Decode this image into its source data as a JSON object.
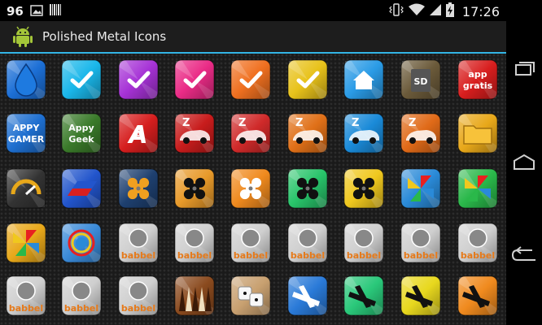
{
  "status_bar": {
    "notification_count": "96",
    "time": "17:26",
    "icons": [
      "image-icon",
      "barcode-icon",
      "vibrate-icon",
      "wifi-icon",
      "signal-icon",
      "battery-charging-icon"
    ]
  },
  "action_bar": {
    "title": "Polished Metal Icons",
    "app_icon": "android-robot-icon",
    "accent_color": "#33b5e5"
  },
  "navigation_bar": {
    "buttons": [
      "recents-icon",
      "home-icon",
      "back-icon"
    ]
  },
  "icon_grid": {
    "rows": [
      [
        {
          "name": "blue-drop-icon",
          "color": "#1c6fd6"
        },
        {
          "name": "cyan-check-icon",
          "color": "#1ab7ea"
        },
        {
          "name": "purple-check-icon",
          "color": "#a632d6"
        },
        {
          "name": "pink-check-icon",
          "color": "#ea2b86"
        },
        {
          "name": "orange-check-icon",
          "color": "#f07020"
        },
        {
          "name": "yellow-check-icon",
          "color": "#e8c21a"
        },
        {
          "name": "home-icon",
          "color": "#2a9be6"
        },
        {
          "name": "sd-card-icon",
          "color": "#6b5a3a"
        },
        {
          "name": "app-gratis-icon",
          "color": "#d81e1e",
          "text": "app\ngratis"
        }
      ],
      [
        {
          "name": "appy-gamer-icon",
          "color": "#1e6fd0",
          "text": "APPY\nGAMER"
        },
        {
          "name": "appy-geek-icon",
          "color": "#3a7a2a",
          "text": "Appy\nGeek"
        },
        {
          "name": "red-a-icon",
          "color": "#d61e1e",
          "text": "A"
        },
        {
          "name": "red-car-icon",
          "color": "#c81c1c"
        },
        {
          "name": "red-car-icon-2",
          "color": "#d02a2a"
        },
        {
          "name": "orange-car-icon",
          "color": "#e07018"
        },
        {
          "name": "blue-car-icon",
          "color": "#1a8ad8"
        },
        {
          "name": "orange-car-icon-2",
          "color": "#e06a18"
        },
        {
          "name": "folder-icon",
          "color": "#e8a81a"
        }
      ],
      [
        {
          "name": "gauge-icon",
          "color": "#333333"
        },
        {
          "name": "flag-stripes-icon",
          "color": "#2255cc"
        },
        {
          "name": "orange-fan-icon",
          "color": "#1e4070"
        },
        {
          "name": "orange-fan-icon-2",
          "color": "#e89a2a"
        },
        {
          "name": "white-fan-icon",
          "color": "#f08a1e"
        },
        {
          "name": "green-fan-icon",
          "color": "#28c46a"
        },
        {
          "name": "yellow-fan-icon",
          "color": "#f0c81e"
        },
        {
          "name": "pinwheel-icon",
          "color": "#2a8ad8"
        },
        {
          "name": "pinwheel-icon-2",
          "color": "#2ab84a"
        }
      ],
      [
        {
          "name": "pinwheel-icon-3",
          "color": "#e8a81a"
        },
        {
          "name": "rainbow-disc-icon",
          "color": "#3a8ad8"
        },
        {
          "name": "babbel-uk-icon",
          "color": "#cfcfcf",
          "text": "babbel"
        },
        {
          "name": "babbel-france-icon",
          "color": "#cfcfcf",
          "text": "babbel"
        },
        {
          "name": "babbel-germany-icon",
          "color": "#cfcfcf",
          "text": "babbel"
        },
        {
          "name": "babbel-spain-icon",
          "color": "#cfcfcf",
          "text": "babbel"
        },
        {
          "name": "babbel-italy-icon",
          "color": "#cfcfcf",
          "text": "babbel"
        },
        {
          "name": "babbel-poland-icon",
          "color": "#cfcfcf",
          "text": "babbel"
        },
        {
          "name": "babbel-brazil-icon",
          "color": "#cfcfcf",
          "text": "babbel"
        }
      ],
      [
        {
          "name": "babbel-macedonia-icon",
          "color": "#cfcfcf",
          "text": "babbel"
        },
        {
          "name": "babbel-sweden-icon",
          "color": "#cfcfcf",
          "text": "babbel"
        },
        {
          "name": "babbel-turkey-icon",
          "color": "#cfcfcf",
          "text": "babbel"
        },
        {
          "name": "backgammon-icon",
          "color": "#8a4a1e"
        },
        {
          "name": "dice-icon",
          "color": "#c8a070"
        },
        {
          "name": "white-clip-icon",
          "color": "#2a7ad8"
        },
        {
          "name": "black-clip-icon",
          "color": "#2ac87a"
        },
        {
          "name": "black-clip-icon-2",
          "color": "#e8d81e"
        },
        {
          "name": "black-clip-icon-3",
          "color": "#f08a1e"
        }
      ]
    ]
  }
}
